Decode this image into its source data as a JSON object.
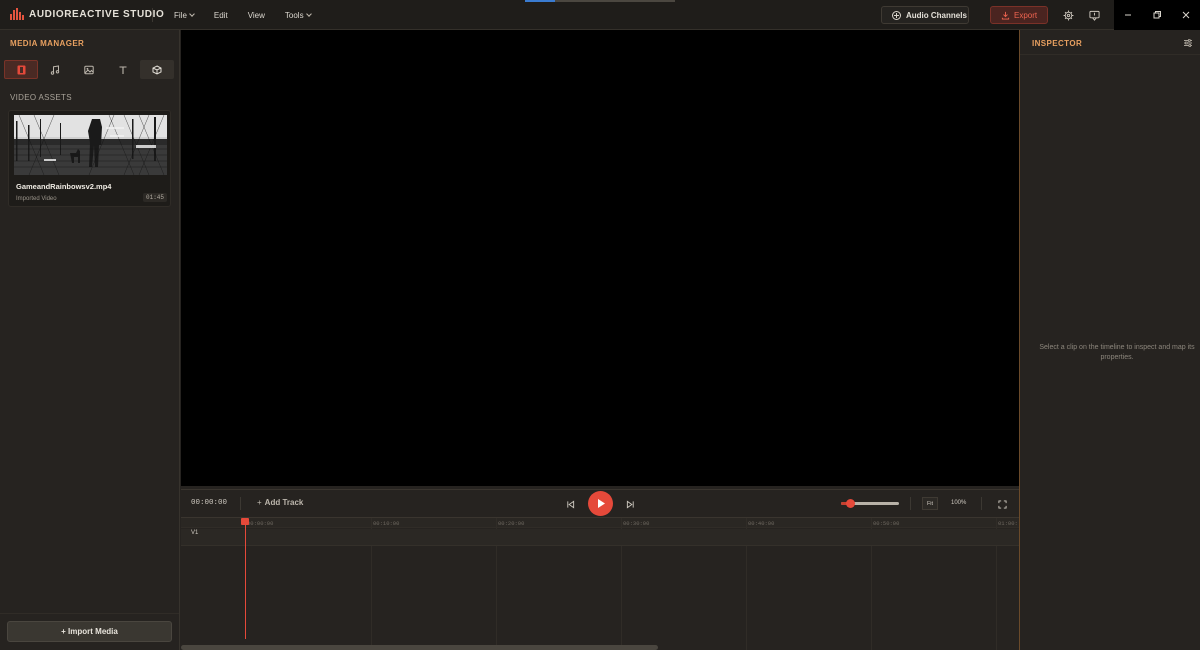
{
  "app": {
    "name": "AUDIOREACTIVE STUDIO",
    "accent": "#e5493a",
    "panel_title_color": "#e8a060"
  },
  "menu": [
    {
      "label": "File",
      "has_dropdown": true
    },
    {
      "label": "Edit",
      "has_dropdown": false
    },
    {
      "label": "View",
      "has_dropdown": false
    },
    {
      "label": "Tools",
      "has_dropdown": true
    }
  ],
  "header": {
    "audio_channels_label": "Audio Channels",
    "export_label": "Export",
    "icons": [
      "plus-circle-icon",
      "download-icon",
      "gear-icon",
      "feedback-icon",
      "minimize-icon",
      "restore-icon",
      "close-icon"
    ]
  },
  "media_manager": {
    "title": "MEDIA MANAGER",
    "tabs": [
      {
        "icon": "film-icon",
        "active": true
      },
      {
        "icon": "music-icon",
        "active": false
      },
      {
        "icon": "image-icon",
        "active": false
      },
      {
        "icon": "text-icon",
        "active": false
      },
      {
        "icon": "cube-icon",
        "active": false
      }
    ],
    "section_label": "VIDEO ASSETS",
    "assets": [
      {
        "name": "GameandRainbowsv2.mp4",
        "type": "Imported Video",
        "duration": "01:45"
      }
    ],
    "import_button": "+ Import Media"
  },
  "transport": {
    "timecode": "00:00:00",
    "add_track": "Add Track",
    "zoom_slider_level": 0.15,
    "fit_label": "Fit",
    "zoom_percent": "100%"
  },
  "timeline": {
    "ruler_labels": [
      "00:00:00",
      "00:10:00",
      "00:20:00",
      "00:30:00",
      "00:40:00",
      "00:50:00",
      "01:00:"
    ],
    "tracks": [
      {
        "label": "V1"
      }
    ]
  },
  "inspector": {
    "title": "INSPECTOR",
    "empty_message": "Select a clip on the timeline to inspect and map its properties."
  }
}
